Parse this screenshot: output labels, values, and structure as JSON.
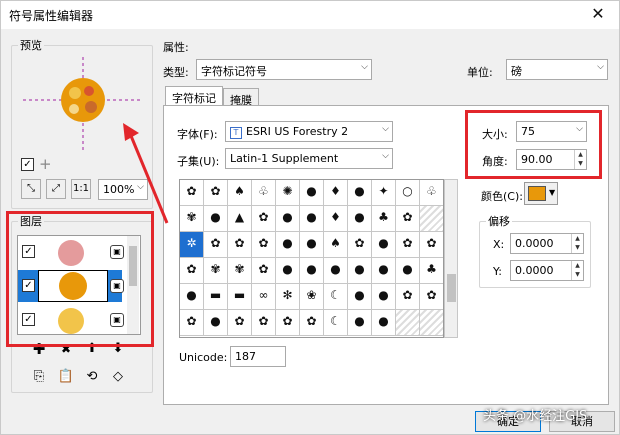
{
  "window": {
    "title": "符号属性编辑器",
    "close_glyph": "✕"
  },
  "preview": {
    "label": "预览",
    "zoom": "100%"
  },
  "layers": {
    "label": "图层"
  },
  "properties": {
    "label": "属性:",
    "type_label": "类型:",
    "type_value": "字符标记符号",
    "unit_label": "单位:",
    "unit_value": "磅"
  },
  "tabs": [
    {
      "label": "字符标记"
    },
    {
      "label": "掩膜"
    }
  ],
  "font": {
    "label": "字体(F):",
    "value": "ESRI US Forestry 2"
  },
  "subset": {
    "label": "子集(U):",
    "value": "Latin-1 Supplement"
  },
  "size": {
    "label": "大小:",
    "value": "75"
  },
  "angle": {
    "label": "角度:",
    "value": "90.00"
  },
  "color": {
    "label": "颜色(C):",
    "swatch": "#e8980a"
  },
  "offset": {
    "label": "偏移",
    "x_label": "X:",
    "x_value": "0.0000",
    "y_label": "Y:",
    "y_value": "0.0000"
  },
  "unicode": {
    "label": "Unicode:",
    "value": "187"
  },
  "buttons": {
    "ok": "确定",
    "cancel": "取消"
  },
  "watermark": "头条 @水经注GIS",
  "glyphs": [
    [
      "✿",
      "✿",
      "♠",
      "♧",
      "✺",
      "●",
      "♦",
      "●",
      "✦",
      "○",
      "♧"
    ],
    [
      "✾",
      "●",
      "▲",
      "✿",
      "●",
      "●",
      "♦",
      "●",
      "♣",
      "✿"
    ],
    [
      "✲",
      "✿",
      "✿",
      "✿",
      "●",
      "●",
      "♠",
      "✿",
      "●",
      "✿",
      "✿"
    ],
    [
      "✿",
      "✾",
      "✾",
      "✿",
      "●",
      "●",
      "●",
      "●",
      "●",
      "●",
      "♣"
    ],
    [
      "●",
      "▬",
      "▬",
      "∞",
      "✻",
      "❀",
      "☾",
      "●",
      "●",
      "✿",
      "✿"
    ],
    [
      "✿",
      "●",
      "✿",
      "✿",
      "✿",
      "✿",
      "☾",
      "●",
      "●"
    ]
  ]
}
